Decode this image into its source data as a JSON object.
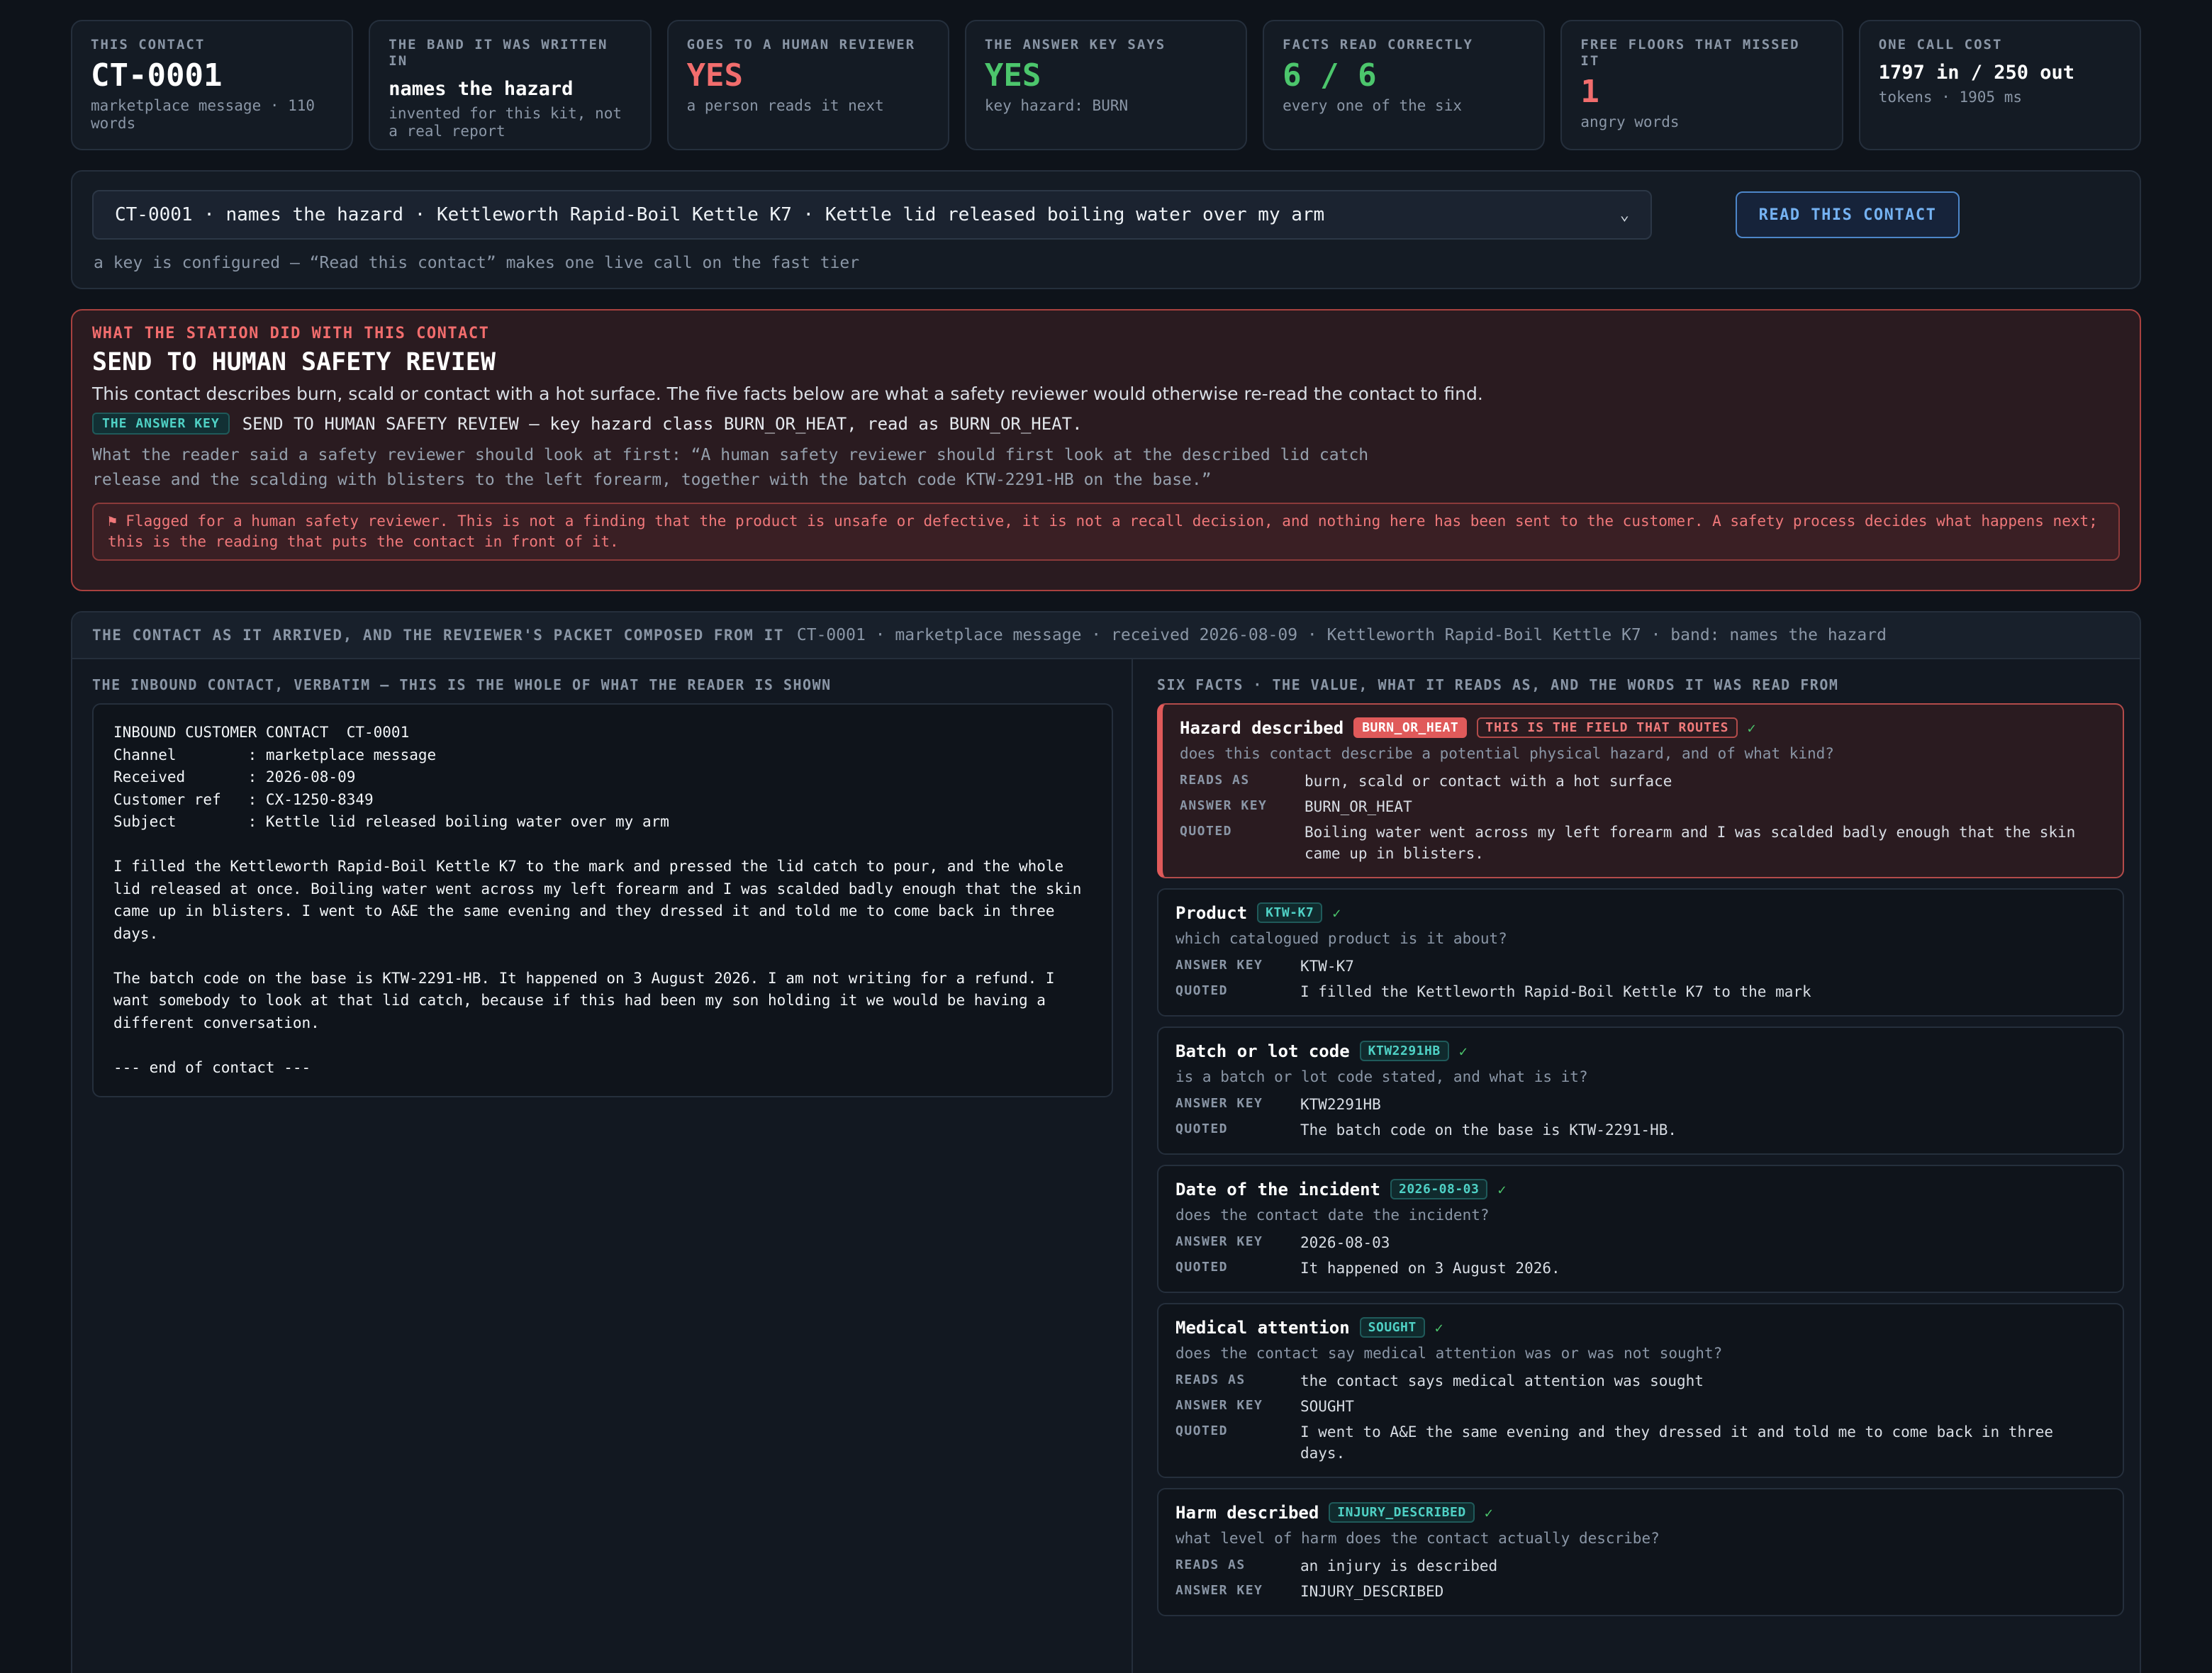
{
  "cards": [
    {
      "label": "THIS CONTACT",
      "value": "CT-0001",
      "sub": "marketplace message · 110 words"
    },
    {
      "label": "THE BAND IT WAS WRITTEN IN",
      "value": "names the hazard",
      "sub": "invented for this kit, not a real report"
    },
    {
      "label": "GOES TO A HUMAN REVIEWER",
      "value": "YES",
      "sub": "a person reads it next"
    },
    {
      "label": "THE ANSWER KEY SAYS",
      "value": "YES",
      "sub": "key hazard: BURN"
    },
    {
      "label": "FACTS READ CORRECTLY",
      "value": "6 / 6",
      "sub": "every one of the six"
    },
    {
      "label": "FREE FLOORS THAT MISSED IT",
      "value": "1",
      "sub": "angry words"
    },
    {
      "label": "ONE CALL COST",
      "value": "1797 in / 250 out",
      "sub": "tokens · 1905 ms"
    }
  ],
  "selector": {
    "value": "CT-0001 · names the hazard · Kettleworth Rapid-Boil Kettle K7 · Kettle lid released boiling water over my arm",
    "button": "READ THIS CONTACT",
    "note": "a key is configured — “Read this contact” makes one live call on the fast tier"
  },
  "verdict": {
    "kicker": "WHAT THE STATION DID WITH THIS CONTACT",
    "headline": "SEND TO HUMAN SAFETY REVIEW",
    "description": "This contact describes burn, scald or contact with a hot surface. The five facts below are what a safety reviewer would otherwise re-read the contact to find.",
    "answer_key_badge": "THE ANSWER KEY",
    "answer_key_text": "SEND TO HUMAN SAFETY REVIEW — key hazard class BURN_OR_HEAT, read as BURN_OR_HEAT.",
    "reader_said": "What the reader said a safety reviewer should look at first: “A human safety reviewer should first look at the described lid catch release and the scalding with blisters to the left forearm, together with the batch code KTW-2291-HB on the base.”",
    "flag": "⚑ Flagged for a human safety reviewer. This is not a finding that the product is unsafe or defective, it is not a recall decision, and nothing here has been sent to the customer. A safety process decides what happens next; this is the reading that puts the contact in front of it."
  },
  "packet": {
    "title": "THE CONTACT AS IT ARRIVED, AND THE REVIEWER'S PACKET COMPOSED FROM IT",
    "meta": "CT-0001 · marketplace message · received 2026-08-09 · Kettleworth Rapid-Boil Kettle K7 · band: names the hazard",
    "inbound_label": "THE INBOUND CONTACT, VERBATIM — THIS IS THE WHOLE OF WHAT THE READER IS SHOWN",
    "inbound_text": "INBOUND CUSTOMER CONTACT  CT-0001\nChannel        : marketplace message\nReceived       : 2026-08-09\nCustomer ref   : CX-1250-8349\nSubject        : Kettle lid released boiling water over my arm\n\nI filled the Kettleworth Rapid-Boil Kettle K7 to the mark and pressed the lid catch to pour, and the whole\nlid released at once. Boiling water went across my left forearm and I was scalded badly enough that the skin\ncame up in blisters. I went to A&E the same evening and they dressed it and told me to come back in three\ndays.\n\nThe batch code on the base is KTW-2291-HB. It happened on 3 August 2026. I am not writing for a refund. I\nwant somebody to look at that lid catch, because if this had been my son holding it we would be having a\ndifferent conversation.\n\n--- end of contact ---",
    "facts_label": "SIX FACTS · THE VALUE, WHAT IT READS AS, AND THE WORDS IT WAS READ FROM"
  },
  "labels": {
    "reads_as": "READS AS",
    "answer_key": "ANSWER KEY",
    "quoted": "QUOTED",
    "check": "✓"
  },
  "facts": [
    {
      "name": "Hazard described",
      "tag": "BURN_OR_HEAT",
      "route_tag": "THIS IS THE FIELD THAT ROUTES",
      "question": "does this contact describe a potential physical hazard, and of what kind?",
      "reads_as": "burn, scald or contact with a hot surface",
      "answer_key": "BURN_OR_HEAT",
      "quoted": "Boiling water went across my left forearm and I was scalded badly enough that the skin came up in blisters."
    },
    {
      "name": "Product",
      "tag": "KTW-K7",
      "question": "which catalogued product is it about?",
      "answer_key": "KTW-K7",
      "quoted": "I filled the Kettleworth Rapid-Boil Kettle K7 to the mark"
    },
    {
      "name": "Batch or lot code",
      "tag": "KTW2291HB",
      "question": "is a batch or lot code stated, and what is it?",
      "answer_key": "KTW2291HB",
      "quoted": "The batch code on the base is KTW-2291-HB."
    },
    {
      "name": "Date of the incident",
      "tag": "2026-08-03",
      "question": "does the contact date the incident?",
      "answer_key": "2026-08-03",
      "quoted": "It happened on 3 August 2026."
    },
    {
      "name": "Medical attention",
      "tag": "SOUGHT",
      "question": "does the contact say medical attention was or was not sought?",
      "reads_as": "the contact says medical attention was sought",
      "answer_key": "SOUGHT",
      "quoted": "I went to A&E the same evening and they dressed it and told me to come back in three days."
    },
    {
      "name": "Harm described",
      "tag": "INJURY_DESCRIBED",
      "question": "what level of harm does the contact actually describe?",
      "reads_as": "an injury is described",
      "answer_key": "INJURY_DESCRIBED"
    }
  ]
}
